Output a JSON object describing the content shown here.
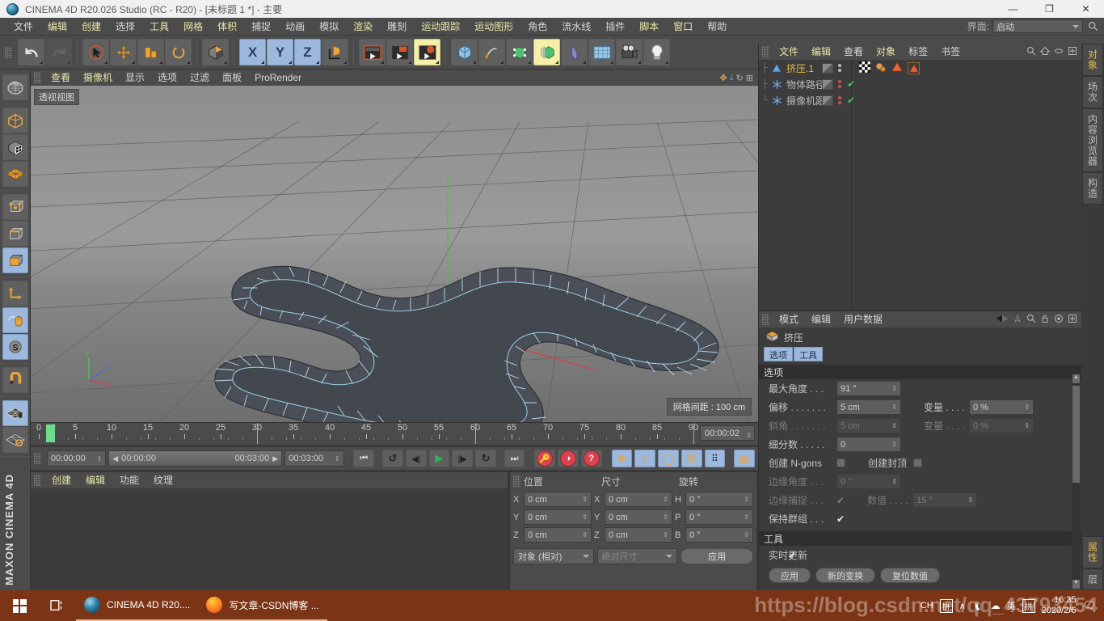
{
  "titlebar": {
    "title": "CINEMA 4D R20.026 Studio (RC - R20) - [未标题 1 *] - 主要",
    "minimize": "—",
    "maximize": "❐",
    "close": "✕"
  },
  "menubar": {
    "items": [
      {
        "label": "文件",
        "hl": false
      },
      {
        "label": "编辑",
        "hl": true
      },
      {
        "label": "创建",
        "hl": true
      },
      {
        "label": "选择",
        "hl": false
      },
      {
        "label": "工具",
        "hl": true
      },
      {
        "label": "网格",
        "hl": true
      },
      {
        "label": "体积",
        "hl": true
      },
      {
        "label": "捕捉",
        "hl": false
      },
      {
        "label": "动画",
        "hl": false
      },
      {
        "label": "模拟",
        "hl": false
      },
      {
        "label": "渲染",
        "hl": true
      },
      {
        "label": "雕刻",
        "hl": false
      },
      {
        "label": "运动跟踪",
        "hl": true
      },
      {
        "label": "运动图形",
        "hl": true
      },
      {
        "label": "角色",
        "hl": false
      },
      {
        "label": "流水线",
        "hl": false
      },
      {
        "label": "插件",
        "hl": false
      },
      {
        "label": "脚本",
        "hl": true
      },
      {
        "label": "窗口",
        "hl": true
      },
      {
        "label": "帮助",
        "hl": false
      }
    ],
    "interface_label": "界面:",
    "interface_value": "启动",
    "search_icon": "search-icon"
  },
  "toolbar": {
    "groups": [
      {
        "buttons": [
          {
            "name": "undo-button",
            "glyph": "↶",
            "state": "normal"
          },
          {
            "name": "redo-button",
            "glyph": "↷",
            "state": "disabled"
          }
        ]
      },
      {
        "buttons": [
          {
            "name": "select-tool-button",
            "glyph": "➤",
            "state": "normal"
          },
          {
            "name": "move-tool-button",
            "glyph": "✥",
            "state": "normal"
          },
          {
            "name": "scale-tool-button",
            "glyph": "▯",
            "state": "normal"
          },
          {
            "name": "rotate-tool-button",
            "glyph": "◯",
            "state": "normal"
          }
        ]
      },
      {
        "buttons": [
          {
            "name": "workplane-button",
            "glyph": "▣",
            "state": "normal"
          }
        ]
      },
      {
        "buttons": [
          {
            "name": "axis-x-lock-button",
            "glyph": "X",
            "state": "selected"
          },
          {
            "name": "axis-y-lock-button",
            "glyph": "Y",
            "state": "selected"
          },
          {
            "name": "axis-z-lock-button",
            "glyph": "Z",
            "state": "selected"
          },
          {
            "name": "object-world-axis-button",
            "glyph": "⌐",
            "state": "normal"
          }
        ]
      },
      {
        "buttons": [
          {
            "name": "render-view-button",
            "glyph": "🎬",
            "state": "normal"
          },
          {
            "name": "render-region-button",
            "glyph": "🎬",
            "state": "normal"
          },
          {
            "name": "render-settings-button",
            "glyph": "🎬",
            "state": "yellow"
          }
        ]
      },
      {
        "buttons": [
          {
            "name": "add-cube-button",
            "glyph": "▤",
            "state": "normal"
          },
          {
            "name": "add-spline-button",
            "glyph": "✎",
            "state": "normal"
          },
          {
            "name": "add-generator-button",
            "glyph": "◈",
            "state": "normal"
          },
          {
            "name": "add-array-button",
            "glyph": "◇",
            "state": "yellow"
          },
          {
            "name": "add-deformer-button",
            "glyph": "◗",
            "state": "normal"
          },
          {
            "name": "add-environment-button",
            "glyph": "▩",
            "state": "normal"
          },
          {
            "name": "add-camera-button",
            "glyph": "📷",
            "state": "normal"
          },
          {
            "name": "add-light-button",
            "glyph": "💡",
            "state": "normal"
          }
        ]
      }
    ]
  },
  "lefttoolbar": {
    "buttons": [
      {
        "name": "render-preview-button",
        "selected": false
      },
      {
        "name": "model-mode-button",
        "selected": false
      },
      {
        "name": "texture-mode-button",
        "selected": false
      },
      {
        "name": "polygon-grid-button",
        "selected": false
      },
      {
        "name": "point-mode-button",
        "selected": false
      },
      {
        "name": "edge-mode-button",
        "selected": false
      },
      {
        "name": "polygon-mode-button",
        "selected": true
      },
      {
        "name": "axis-mode-button",
        "selected": false
      },
      {
        "name": "viewport-solo-button",
        "selected": true
      },
      {
        "name": "soft-selection-button",
        "selected": true
      },
      {
        "name": "snap-magnet-button",
        "selected": false
      },
      {
        "name": "workplane-lock-button",
        "selected": true
      },
      {
        "name": "workplane-rotate-button",
        "selected": false
      }
    ],
    "brand": "MAXON CINEMA 4D"
  },
  "viewport": {
    "menu": [
      "查看",
      "摄像机",
      "显示",
      "选项",
      "过滤",
      "面板",
      "ProRender"
    ],
    "menu_highlight": [
      true,
      true,
      false,
      false,
      false,
      false,
      false
    ],
    "label": "透视视图",
    "grid_status": "网格间距 : 100 cm",
    "axis": {
      "y": "Y",
      "z": "Z",
      "x": "X"
    },
    "nav_icons": [
      "pan-icon",
      "zoom-icon",
      "rotate-icon",
      "maximize-icon"
    ]
  },
  "timeline": {
    "ticks": [
      "0",
      "2",
      "5",
      "10",
      "15",
      "20",
      "25",
      "30",
      "35",
      "40",
      "45",
      "50",
      "55",
      "60",
      "65",
      "70",
      "75",
      "80",
      "85",
      "90"
    ],
    "current_frame_marker": 2,
    "time_display": "00:00:02"
  },
  "transport": {
    "current_time": "00:00:00",
    "range_start": "00:00:00",
    "range_end": "00:03:00",
    "end_time": "00:03:00",
    "buttons": [
      {
        "name": "go-to-start-button",
        "glyph": "|◀◀"
      },
      {
        "name": "play-reverse-loop-button",
        "glyph": "↺"
      },
      {
        "name": "step-back-button",
        "glyph": "◀|"
      },
      {
        "name": "play-button",
        "glyph": "▶"
      },
      {
        "name": "step-forward-button",
        "glyph": "|▶"
      },
      {
        "name": "loop-button",
        "glyph": "↻"
      },
      {
        "name": "go-to-end-button",
        "glyph": "▶▶|"
      },
      {
        "name": "record-keyframe-button",
        "glyph": "🔑"
      },
      {
        "name": "autokeying-button",
        "glyph": "◑"
      },
      {
        "name": "keyframe-selection-button",
        "glyph": "?"
      },
      {
        "name": "position-key-button",
        "glyph": "✥"
      },
      {
        "name": "scale-key-button",
        "glyph": "▯"
      },
      {
        "name": "rotation-key-button",
        "glyph": "◯"
      },
      {
        "name": "pla-key-button",
        "glyph": "P"
      },
      {
        "name": "point-level-anim-button",
        "glyph": "⠿"
      },
      {
        "name": "timeline-keyframe-button",
        "glyph": "▤"
      }
    ]
  },
  "material_manager": {
    "menu": [
      "创建",
      "编辑",
      "功能",
      "纹理"
    ],
    "menu_highlight": [
      true,
      true,
      false,
      false
    ]
  },
  "coordinates": {
    "headers": [
      "位置",
      "尺寸",
      "旋转"
    ],
    "rows": [
      {
        "pos_label": "X",
        "pos_value": "0 cm",
        "size_label": "X",
        "size_value": "0 cm",
        "rot_label": "H",
        "rot_value": "0 °"
      },
      {
        "pos_label": "Y",
        "pos_value": "0 cm",
        "size_label": "Y",
        "size_value": "0 cm",
        "rot_label": "P",
        "rot_value": "0 °"
      },
      {
        "pos_label": "Z",
        "pos_value": "0 cm",
        "size_label": "Z",
        "size_value": "0 cm",
        "rot_label": "B",
        "rot_value": "0 °"
      }
    ],
    "mode_select": "对象 (相对)",
    "size_select": "绝对尺寸",
    "apply_button": "应用"
  },
  "object_manager": {
    "menu": [
      "文件",
      "编辑",
      "查看",
      "对象",
      "标签",
      "书签"
    ],
    "menu_highlight": [
      true,
      true,
      false,
      true,
      false,
      false
    ],
    "icons": [
      "search-icon",
      "home-icon",
      "ellipse-icon",
      "maximize-icon"
    ],
    "objects": [
      {
        "name": "挤压.1",
        "selected": true,
        "icon": "extrude-icon",
        "visibility_dots": true,
        "check": false,
        "tags": [
          "checker-tag",
          "material-tag",
          "deformer-tag",
          "deformer-tag-selected"
        ]
      },
      {
        "name": "物体路径",
        "selected": false,
        "icon": "null-icon",
        "visibility_dots": true,
        "check": true,
        "tags": []
      },
      {
        "name": "摄像机跟",
        "selected": false,
        "icon": "null-icon",
        "visibility_dots": true,
        "check": true,
        "tags": []
      }
    ]
  },
  "attribute_manager": {
    "menu": [
      "模式",
      "编辑",
      "用户数据"
    ],
    "menu_highlight": [
      false,
      false,
      false
    ],
    "icons": [
      "back-arrow-icon",
      "forward-arrow-icon",
      "pin-icon",
      "search-icon",
      "lock-icon",
      "target-icon",
      "maximize-icon"
    ],
    "object_name": "挤压",
    "object_icon": "extrude-icon",
    "tabs": [
      "选项",
      "工具"
    ],
    "sections": [
      {
        "title": "选项",
        "rows": [
          {
            "label": "最大角度 . . .",
            "value": "91 °",
            "disabled": false,
            "label2": "",
            "value2": "",
            "disabled2": false
          },
          {
            "label": "偏移 . . . . . . .",
            "value": "5 cm",
            "disabled": false,
            "label2": "变量 . . . .",
            "value2": "0 %",
            "disabled2": false
          },
          {
            "label": "斜角 . . . . . . .",
            "value": "5 cm",
            "disabled": true,
            "label2": "变量 . . . .",
            "value2": "0 %",
            "disabled2": true
          },
          {
            "label": "细分数 . . . . .",
            "value": "0",
            "disabled": false,
            "label2": "",
            "value2": "",
            "disabled2": false
          }
        ],
        "checkrows": [
          {
            "label": "创建 N-gons",
            "type": "toggle",
            "checked": false,
            "disabled": false,
            "label2": "创建封顶",
            "type2": "toggle",
            "checked2": false,
            "disabled2": false
          },
          {
            "label": "边缘角度 . . .",
            "type": "field",
            "value": "0 °",
            "disabled": true,
            "label2": "",
            "type2": "none",
            "checked2": false,
            "disabled2": true
          },
          {
            "label": "边缘捕捉 . . .",
            "type": "check",
            "checked": true,
            "disabled": true,
            "label2": "数值 . . . .",
            "type2": "field",
            "value2": "15 °",
            "disabled2": true
          },
          {
            "label": "保持群组 . . .",
            "type": "check",
            "checked": true,
            "disabled": false,
            "label2": "",
            "type2": "none",
            "checked2": false,
            "disabled2": false
          }
        ]
      },
      {
        "title": "工具",
        "toolrow": {
          "label": "实时更新",
          "checked": true
        },
        "buttons": [
          "应用",
          "新的变换",
          "复位数值"
        ]
      }
    ]
  },
  "vertical_tabs": {
    "top": [
      {
        "label": "对象",
        "selected": true
      },
      {
        "label": "场次",
        "selected": false
      },
      {
        "label": "内容浏览器",
        "selected": false
      },
      {
        "label": "构造",
        "selected": false
      }
    ],
    "bottom": [
      {
        "label": "属性",
        "selected": true
      },
      {
        "label": "层",
        "selected": false
      }
    ]
  },
  "taskbar": {
    "start_icon": "windows-logo-icon",
    "taskview_icon": "task-view-icon",
    "apps": [
      {
        "name": "CINEMA 4D R20....",
        "icon": "c4d-icon"
      },
      {
        "name": "写文章-CSDN博客 ...",
        "icon": "firefox-icon"
      }
    ],
    "tray": {
      "input_lang": "CH",
      "ime_icon": "pinyin-icon",
      "chevron": "∧",
      "icons": [
        "qq-icon",
        "cloud-icon",
        "eng-icon",
        "pinyin2-icon"
      ],
      "time": "16:35",
      "date": "2020/2/6",
      "notification_icon": "notification-icon"
    }
  },
  "watermark": "https://blog.csdn.net/qq_43793454",
  "colors": {
    "accent": "#e8b84b",
    "selection": "#9cb8dd",
    "panel": "#4b4b4b",
    "dark_panel": "#3c3c3c",
    "taskbar": "#7b3415"
  }
}
